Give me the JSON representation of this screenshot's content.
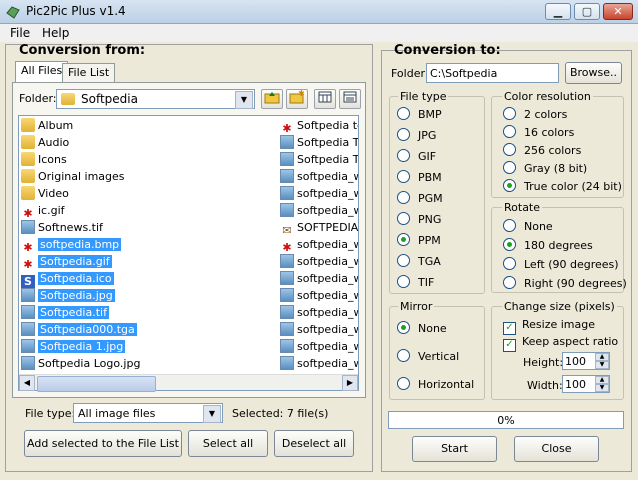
{
  "window": {
    "title": "Pic2Pic Plus v1.4"
  },
  "menu": {
    "file": "File",
    "help": "Help"
  },
  "from": {
    "title": "Conversion from:",
    "tabs": {
      "all_files": "All Files",
      "file_list": "File List"
    },
    "folder_label": "Folder:",
    "folder_value": "Softpedia",
    "files_left": [
      {
        "name": "Album",
        "icon": "folder-icon",
        "selected": false
      },
      {
        "name": "Audio",
        "icon": "folder-icon",
        "selected": false
      },
      {
        "name": "Icons",
        "icon": "folder-icon",
        "selected": false
      },
      {
        "name": "Original images",
        "icon": "folder-icon",
        "selected": false
      },
      {
        "name": "Video",
        "icon": "folder-icon",
        "selected": false
      },
      {
        "name": "ic.gif",
        "icon": "gif-icon",
        "selected": false
      },
      {
        "name": "Softnews.tif",
        "icon": "image-icon",
        "selected": false
      },
      {
        "name": "softpedia.bmp",
        "icon": "bmp-icon",
        "selected": true
      },
      {
        "name": "Softpedia.gif",
        "icon": "gif-icon",
        "selected": true
      },
      {
        "name": "Softpedia.ico",
        "icon": "ico-icon",
        "selected": true
      },
      {
        "name": "Softpedia.jpg",
        "icon": "image-icon",
        "selected": true
      },
      {
        "name": "Softpedia.tif",
        "icon": "image-icon",
        "selected": true
      },
      {
        "name": "Softpedia000.tga",
        "icon": "image-icon",
        "selected": true
      },
      {
        "name": "Softpedia 1.jpg",
        "icon": "image-icon",
        "selected": true
      },
      {
        "name": "Softpedia Logo.jpg",
        "icon": "image-icon",
        "selected": false
      }
    ],
    "files_right": [
      {
        "name": "Softpedia tes",
        "icon": "gif-icon"
      },
      {
        "name": "Softpedia Te",
        "icon": "image-icon"
      },
      {
        "name": "Softpedia Te",
        "icon": "image-icon"
      },
      {
        "name": "softpedia_wa",
        "icon": "image-icon"
      },
      {
        "name": "softpedia_wa",
        "icon": "image-icon"
      },
      {
        "name": "softpedia_wa",
        "icon": "image-icon"
      },
      {
        "name": "SOFTPEDIA_",
        "icon": "stamp-icon"
      },
      {
        "name": "softpedia_wa",
        "icon": "gif-icon"
      },
      {
        "name": "softpedia_wa",
        "icon": "image-icon"
      },
      {
        "name": "softpedia_wa",
        "icon": "image-icon"
      },
      {
        "name": "softpedia_wa",
        "icon": "image-icon"
      },
      {
        "name": "softpedia_wa",
        "icon": "image-icon"
      },
      {
        "name": "softpedia_wa",
        "icon": "image-icon"
      },
      {
        "name": "softpedia_wa",
        "icon": "image-icon"
      },
      {
        "name": "softpedia_wa",
        "icon": "image-icon"
      }
    ],
    "file_type_label": "File type:",
    "file_type_value": "All image files",
    "selected_text": "Selected: 7 file(s)",
    "add_button": "Add selected to the File List",
    "select_all_button": "Select all",
    "deselect_all_button": "Deselect all"
  },
  "to": {
    "title": "Conversion to:",
    "folder_label": "Folder:",
    "folder_value": "C:\\Softpedia",
    "browse_button": "Browse..",
    "file_type": {
      "label": "File type",
      "options": [
        "BMP",
        "JPG",
        "GIF",
        "PBM",
        "PGM",
        "PNG",
        "PPM",
        "TGA",
        "TIF"
      ],
      "selected": "PPM"
    },
    "color_resolution": {
      "label": "Color resolution",
      "options": [
        "2 colors",
        "16 colors",
        "256 colors",
        "Gray (8 bit)",
        "True color (24 bit)"
      ],
      "selected": "True color (24 bit)"
    },
    "rotate": {
      "label": "Rotate",
      "options": [
        "None",
        "180 degrees",
        "Left (90 degrees)",
        "Right (90 degrees)"
      ],
      "selected": "180 degrees"
    },
    "mirror": {
      "label": "Mirror",
      "options": [
        "None",
        "Vertical",
        "Horizontal"
      ],
      "selected": "None"
    },
    "change_size": {
      "label": "Change size (pixels)",
      "resize_image": "Resize image",
      "keep_aspect": "Keep aspect ratio",
      "height_label": "Height:",
      "height_value": "100",
      "width_label": "Width:",
      "width_value": "100"
    },
    "progress_text": "0%",
    "progress": 0,
    "start_button": "Start",
    "close_button": "Close"
  }
}
